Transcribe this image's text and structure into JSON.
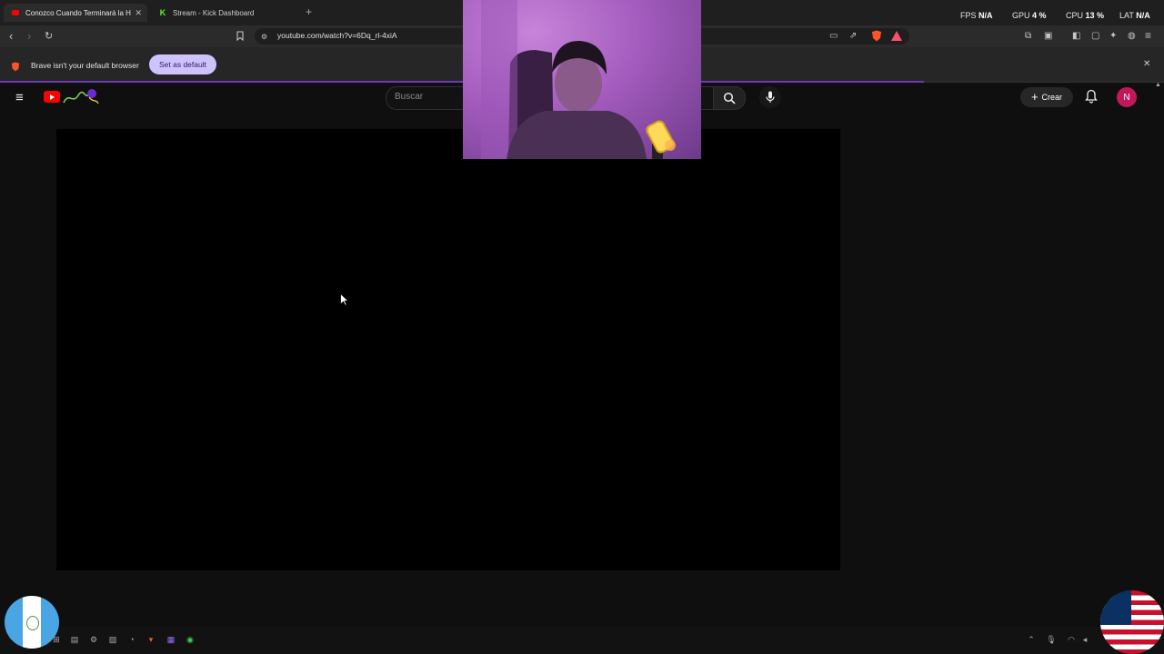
{
  "browser": {
    "tabs": [
      {
        "title": "Conozco Cuando Terminará la H",
        "active": true,
        "favicon": "youtube-icon",
        "close": "✕"
      },
      {
        "title": "Stream - Kick Dashboard",
        "active": false,
        "favicon": "kick-icon"
      }
    ],
    "new_tab": "+",
    "overlay_stats": [
      {
        "label": "FPS",
        "value": "N/A"
      },
      {
        "label": "GPU",
        "value": "4 %"
      },
      {
        "label": "CPU",
        "value": "13 %"
      },
      {
        "label": "LAT",
        "value": "N/A"
      }
    ],
    "url": "youtube.com/watch?v=6Dq_rl-4xiA",
    "infobar": {
      "message": "Brave isn't your default browser",
      "button": "Set as default",
      "close": "✕"
    }
  },
  "youtube": {
    "search_placeholder": "Buscar",
    "create_label": "Crear",
    "avatar_initial": "N"
  },
  "colors": {
    "accent_purple": "#8c44ff",
    "youtube_red": "#ff0000",
    "button_lavender": "#cfc3ff",
    "avatar": "#c2185b"
  }
}
